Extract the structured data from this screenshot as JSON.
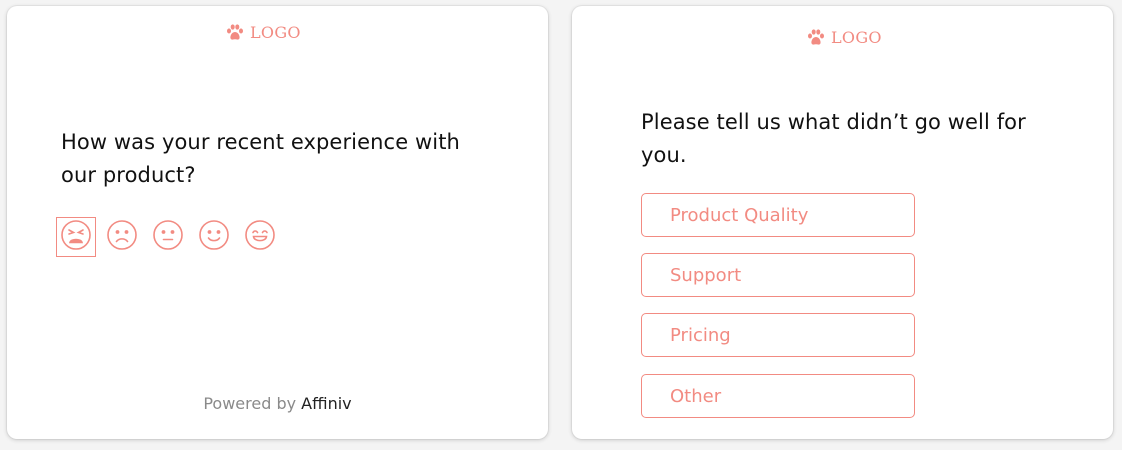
{
  "theme": {
    "accent": "#f28b82",
    "text": "#111111",
    "muted": "#8a8a8a"
  },
  "left_card": {
    "logo": {
      "icon": "paw-icon",
      "text": "LOGO"
    },
    "question": "How was your recent experience with our product?",
    "rating": {
      "options": [
        {
          "icon": "angry-face-icon"
        },
        {
          "icon": "sad-face-icon"
        },
        {
          "icon": "neutral-face-icon"
        },
        {
          "icon": "smile-face-icon"
        },
        {
          "icon": "grin-face-icon"
        }
      ],
      "selected_index": 0
    },
    "footer": {
      "prefix": "Powered by ",
      "brand": "Affiniv"
    }
  },
  "right_card": {
    "logo": {
      "icon": "paw-icon",
      "text": "LOGO"
    },
    "question": "Please tell us what didn’t go well for you.",
    "options": [
      "Product Quality",
      "Support",
      "Pricing",
      "Other"
    ]
  }
}
